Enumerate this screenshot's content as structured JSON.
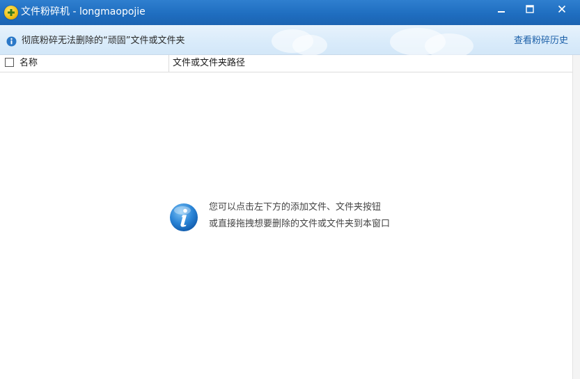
{
  "window": {
    "title": "文件粉碎机 - longmaopojie"
  },
  "infobar": {
    "message": "彻底粉碎无法删除的“顽固”文件或文件夹",
    "history_link": "查看粉碎历史"
  },
  "table": {
    "columns": [
      "名称",
      "文件或文件夹路径"
    ]
  },
  "empty_hint": {
    "line1": "您可以点击左下方的添加文件、文件夹按钮",
    "line2": "或直接拖拽想要删除的文件或文件夹到本窗口"
  },
  "icons": {
    "app": "shredder-app-icon",
    "info": "info-icon",
    "hint": "info-large-icon",
    "minimize": "minimize-icon",
    "maximize": "maximize-icon",
    "close": "close-icon"
  },
  "colors": {
    "titlebar": "#1f6ec0",
    "infobar": "#d9ebfa",
    "link": "#1b5fa8",
    "info_icon": "#2a78c8"
  }
}
